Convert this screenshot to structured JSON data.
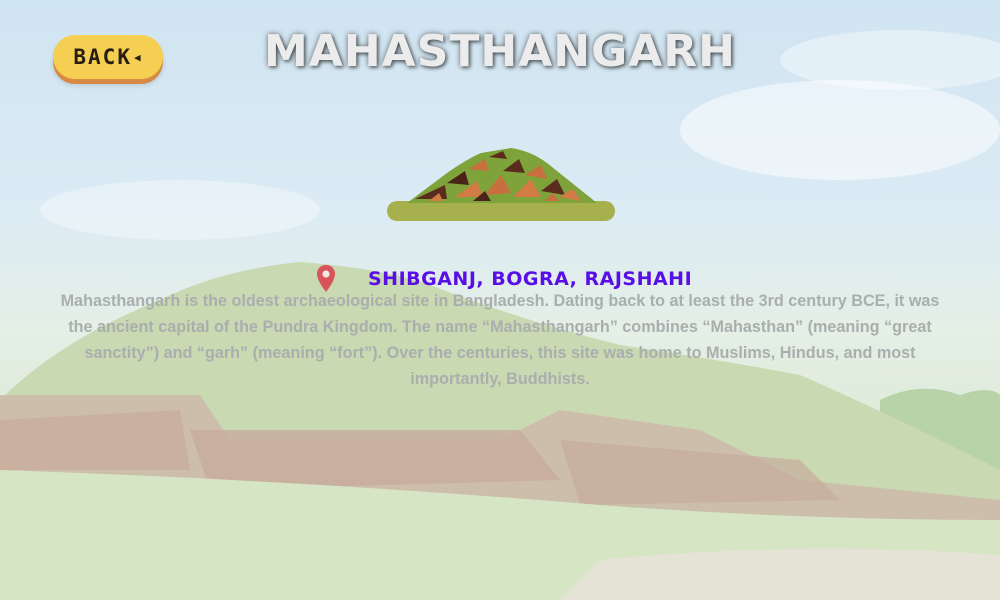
{
  "header": {
    "back_label": "BACK",
    "title": "MAHASTHANGARH"
  },
  "location": {
    "text": "SHIBGANJ, BOGRA, RAJSHAHI"
  },
  "description": "Mahasthangarh is the oldest archaeological site in Bangladesh. Dating back to at least the 3rd century BCE, it was the ancient capital of the Pundra Kingdom. The name “Mahasthangarh” combines “Mahasthan” (meaning “great sanctity”) and “garh” (meaning “fort”). Over the centuries, this site was home to Muslims, Hindus, and most importantly, Buddhists.",
  "colors": {
    "back_button": "#f4cf52",
    "back_button_shadow": "#d78a46",
    "location_text": "#5a0ee6",
    "pin": "#d9545a",
    "description_text": "#a9aeae"
  },
  "icons": {
    "back": "triangle-left-icon",
    "location": "map-pin-icon",
    "site": "mound-illustration"
  }
}
